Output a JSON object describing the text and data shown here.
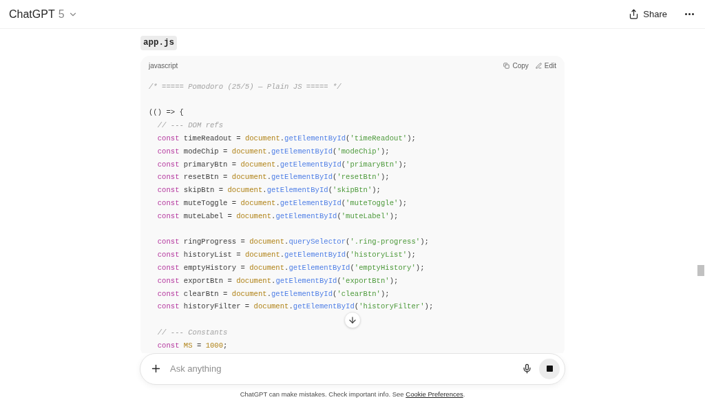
{
  "header": {
    "title": "ChatGPT",
    "model": "5",
    "share": "Share"
  },
  "file_name": "app.js",
  "code_block": {
    "language": "javascript",
    "copy": "Copy",
    "edit": "Edit",
    "lines": [
      {
        "kind": "code",
        "tokens": [
          {
            "kind": "comment",
            "t": "/* ===== Pomodoro (25/5) — Plain JS ===== */"
          }
        ]
      },
      {
        "kind": "blank"
      },
      {
        "kind": "code",
        "tokens": [
          {
            "kind": "plain",
            "t": "(() => {"
          }
        ]
      },
      {
        "kind": "code",
        "tokens": [
          {
            "kind": "comment",
            "t": "  // --- DOM refs"
          }
        ]
      },
      {
        "kind": "code",
        "tokens": [
          {
            "kind": "keyword",
            "t": "  const "
          },
          {
            "kind": "plain",
            "t": "timeReadout = "
          },
          {
            "kind": "object",
            "t": "document"
          },
          {
            "kind": "plain",
            "t": "."
          },
          {
            "kind": "method",
            "t": "getElementById"
          },
          {
            "kind": "plain",
            "t": "("
          },
          {
            "kind": "string",
            "t": "'timeReadout'"
          },
          {
            "kind": "plain",
            "t": ");"
          }
        ]
      },
      {
        "kind": "code",
        "tokens": [
          {
            "kind": "keyword",
            "t": "  const "
          },
          {
            "kind": "plain",
            "t": "modeChip = "
          },
          {
            "kind": "object",
            "t": "document"
          },
          {
            "kind": "plain",
            "t": "."
          },
          {
            "kind": "method",
            "t": "getElementById"
          },
          {
            "kind": "plain",
            "t": "("
          },
          {
            "kind": "string",
            "t": "'modeChip'"
          },
          {
            "kind": "plain",
            "t": ");"
          }
        ]
      },
      {
        "kind": "code",
        "tokens": [
          {
            "kind": "keyword",
            "t": "  const "
          },
          {
            "kind": "plain",
            "t": "primaryBtn = "
          },
          {
            "kind": "object",
            "t": "document"
          },
          {
            "kind": "plain",
            "t": "."
          },
          {
            "kind": "method",
            "t": "getElementById"
          },
          {
            "kind": "plain",
            "t": "("
          },
          {
            "kind": "string",
            "t": "'primaryBtn'"
          },
          {
            "kind": "plain",
            "t": ");"
          }
        ]
      },
      {
        "kind": "code",
        "tokens": [
          {
            "kind": "keyword",
            "t": "  const "
          },
          {
            "kind": "plain",
            "t": "resetBtn = "
          },
          {
            "kind": "object",
            "t": "document"
          },
          {
            "kind": "plain",
            "t": "."
          },
          {
            "kind": "method",
            "t": "getElementById"
          },
          {
            "kind": "plain",
            "t": "("
          },
          {
            "kind": "string",
            "t": "'resetBtn'"
          },
          {
            "kind": "plain",
            "t": ");"
          }
        ]
      },
      {
        "kind": "code",
        "tokens": [
          {
            "kind": "keyword",
            "t": "  const "
          },
          {
            "kind": "plain",
            "t": "skipBtn = "
          },
          {
            "kind": "object",
            "t": "document"
          },
          {
            "kind": "plain",
            "t": "."
          },
          {
            "kind": "method",
            "t": "getElementById"
          },
          {
            "kind": "plain",
            "t": "("
          },
          {
            "kind": "string",
            "t": "'skipBtn'"
          },
          {
            "kind": "plain",
            "t": ");"
          }
        ]
      },
      {
        "kind": "code",
        "tokens": [
          {
            "kind": "keyword",
            "t": "  const "
          },
          {
            "kind": "plain",
            "t": "muteToggle = "
          },
          {
            "kind": "object",
            "t": "document"
          },
          {
            "kind": "plain",
            "t": "."
          },
          {
            "kind": "method",
            "t": "getElementById"
          },
          {
            "kind": "plain",
            "t": "("
          },
          {
            "kind": "string",
            "t": "'muteToggle'"
          },
          {
            "kind": "plain",
            "t": ");"
          }
        ]
      },
      {
        "kind": "code",
        "tokens": [
          {
            "kind": "keyword",
            "t": "  const "
          },
          {
            "kind": "plain",
            "t": "muteLabel = "
          },
          {
            "kind": "object",
            "t": "document"
          },
          {
            "kind": "plain",
            "t": "."
          },
          {
            "kind": "method",
            "t": "getElementById"
          },
          {
            "kind": "plain",
            "t": "("
          },
          {
            "kind": "string",
            "t": "'muteLabel'"
          },
          {
            "kind": "plain",
            "t": ");"
          }
        ]
      },
      {
        "kind": "blank"
      },
      {
        "kind": "code",
        "tokens": [
          {
            "kind": "keyword",
            "t": "  const "
          },
          {
            "kind": "plain",
            "t": "ringProgress = "
          },
          {
            "kind": "object",
            "t": "document"
          },
          {
            "kind": "plain",
            "t": "."
          },
          {
            "kind": "method",
            "t": "querySelector"
          },
          {
            "kind": "plain",
            "t": "("
          },
          {
            "kind": "string",
            "t": "'.ring-progress'"
          },
          {
            "kind": "plain",
            "t": ");"
          }
        ]
      },
      {
        "kind": "code",
        "tokens": [
          {
            "kind": "keyword",
            "t": "  const "
          },
          {
            "kind": "plain",
            "t": "historyList = "
          },
          {
            "kind": "object",
            "t": "document"
          },
          {
            "kind": "plain",
            "t": "."
          },
          {
            "kind": "method",
            "t": "getElementById"
          },
          {
            "kind": "plain",
            "t": "("
          },
          {
            "kind": "string",
            "t": "'historyList'"
          },
          {
            "kind": "plain",
            "t": ");"
          }
        ]
      },
      {
        "kind": "code",
        "tokens": [
          {
            "kind": "keyword",
            "t": "  const "
          },
          {
            "kind": "plain",
            "t": "emptyHistory = "
          },
          {
            "kind": "object",
            "t": "document"
          },
          {
            "kind": "plain",
            "t": "."
          },
          {
            "kind": "method",
            "t": "getElementById"
          },
          {
            "kind": "plain",
            "t": "("
          },
          {
            "kind": "string",
            "t": "'emptyHistory'"
          },
          {
            "kind": "plain",
            "t": ");"
          }
        ]
      },
      {
        "kind": "code",
        "tokens": [
          {
            "kind": "keyword",
            "t": "  const "
          },
          {
            "kind": "plain",
            "t": "exportBtn = "
          },
          {
            "kind": "object",
            "t": "document"
          },
          {
            "kind": "plain",
            "t": "."
          },
          {
            "kind": "method",
            "t": "getElementById"
          },
          {
            "kind": "plain",
            "t": "("
          },
          {
            "kind": "string",
            "t": "'exportBtn'"
          },
          {
            "kind": "plain",
            "t": ");"
          }
        ]
      },
      {
        "kind": "code",
        "tokens": [
          {
            "kind": "keyword",
            "t": "  const "
          },
          {
            "kind": "plain",
            "t": "clearBtn = "
          },
          {
            "kind": "object",
            "t": "document"
          },
          {
            "kind": "plain",
            "t": "."
          },
          {
            "kind": "method",
            "t": "getElementById"
          },
          {
            "kind": "plain",
            "t": "("
          },
          {
            "kind": "string",
            "t": "'clearBtn'"
          },
          {
            "kind": "plain",
            "t": ");"
          }
        ]
      },
      {
        "kind": "code",
        "tokens": [
          {
            "kind": "keyword",
            "t": "  const "
          },
          {
            "kind": "plain",
            "t": "historyFilter = "
          },
          {
            "kind": "object",
            "t": "document"
          },
          {
            "kind": "plain",
            "t": "."
          },
          {
            "kind": "method",
            "t": "getElementById"
          },
          {
            "kind": "plain",
            "t": "("
          },
          {
            "kind": "string",
            "t": "'historyFilter'"
          },
          {
            "kind": "plain",
            "t": ");"
          }
        ]
      },
      {
        "kind": "blank"
      },
      {
        "kind": "code",
        "tokens": [
          {
            "kind": "comment",
            "t": "  // --- Constants"
          }
        ]
      },
      {
        "kind": "code",
        "tokens": [
          {
            "kind": "keyword",
            "t": "  const "
          },
          {
            "kind": "object",
            "t": "MS"
          },
          {
            "kind": "plain",
            "t": " = "
          },
          {
            "kind": "object",
            "t": "1000"
          },
          {
            "kind": "plain",
            "t": ";"
          }
        ]
      }
    ]
  },
  "composer": {
    "placeholder": "Ask anything"
  },
  "footer": {
    "text": "ChatGPT can make mistakes. Check important info. See ",
    "link": "Cookie Preferences",
    "end": "."
  }
}
